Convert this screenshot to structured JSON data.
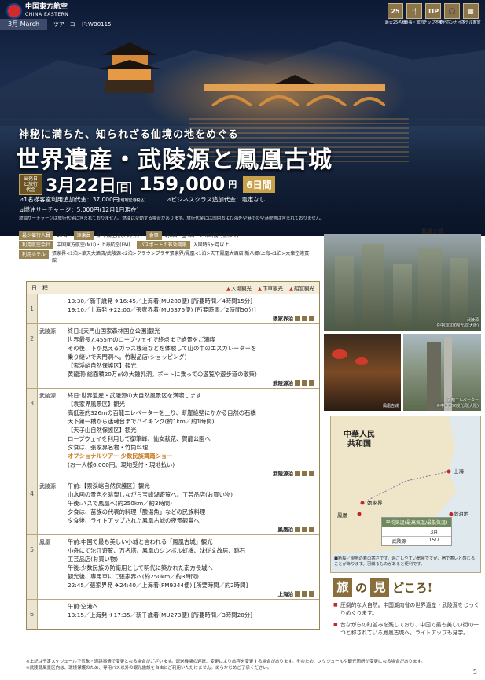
{
  "header": {
    "airline_name": "中国東方航空",
    "airline_en": "CHINA EASTERN",
    "month": "3月 March",
    "tour_code": "ツアーコード:WB0115I",
    "icons": [
      {
        "name": "max-25-icon",
        "symbol": "25",
        "label": "最大25名様"
      },
      {
        "name": "dining-icon",
        "symbol": "🍴",
        "label": "食事・飲料"
      },
      {
        "name": "no-tip-icon",
        "symbol": "TIP",
        "label": "チップ不要"
      },
      {
        "name": "earphone-icon",
        "symbol": "🎧",
        "label": "イヤホンガイド"
      },
      {
        "name": "hotel-icon",
        "symbol": "▦",
        "label": "ホテル客室"
      }
    ]
  },
  "hero": {
    "tagline": "神秘に満ちた、知られざる仙境の地をめぐる",
    "title": "世界遺産・武陵源と鳳凰古城",
    "depart_label": "出発日と旅行代金",
    "date": "3月22日",
    "weekday": "日",
    "price": "159,000",
    "yen": "円",
    "days": "6日間",
    "surcharge_single": "1名様客室利用追加代金：37,000円",
    "surcharge_single_note": "(現地空港税込)",
    "surcharge_business": "ビジネスクラス追加代金：電定なし",
    "surcharge_fuel": "燃油サーチャージ",
    "surcharge_fuel_value": "：5,000円(12月1日現在)",
    "surcharge_note": "燃油サーチャージは旅行代金に含まれておりません。燃油は変動する場合があります。旅行代金には国内および海外空港での空港税等は含まれておりません。"
  },
  "info": {
    "min_people_tag": "最少催行人員",
    "min_people": "10名",
    "escort_tag": "添乗員",
    "escort": "新千歳空港より同行",
    "meals_tag": "食事",
    "meals": "朝5回・昼4回・夕4回(機内食除く)",
    "airline_tag": "利用航空会社",
    "airline": "中国東方航空(MU)・上海航空(FM)",
    "passport_tag": "パスポートの有効期限",
    "passport": "入国時6ヶ月以上",
    "hotel_tag": "利用ホテル",
    "hotel": "張家界<1泊>華天大酒店/武陵源<2泊>クラウンプラザ張家界/鳳凰<1泊>天下鳳凰大酒店 新八郷/上海<1泊>大衆空港賓館"
  },
  "itinerary": {
    "head_day": "日　程",
    "legend_entry": "入場観光",
    "legend_exit": "下車観光",
    "legend_window": "船窓観光",
    "days": [
      {
        "num": "1",
        "place": "",
        "lines": [
          "13:30／新千歳発 ✈16:45／上海着(MU280便) [所要時間／4時間15分]",
          "19:10／上海発 ✈22:00／張家界着(MU5375便) [所要時間／2時間50分]"
        ],
        "stay": "張家界泊"
      },
      {
        "num": "2",
        "place": "武陵源",
        "lines": [
          "終日:[天門山国家森林国立公園]観光",
          "世界最長7,455mのロープウェイで終点まで絶景をご満喫",
          "その後、下が見えるガラス桟道などを体験して山の中のエスカレーターを",
          "乗り継いで天門洞へ。竹製品店(ショッピング)",
          "【索渓峪自然保護区】観光",
          "黄龍洞(総面積20万㎡の大鍾乳洞。ボートに乗っての遊覧や遊歩道の散策)"
        ],
        "stay": "武陵源泊"
      },
      {
        "num": "3",
        "place": "武陵源",
        "lines": [
          "終日:世界遺産・武陵源の大自然風景区を満喫します",
          "【袁家界風景区】観光",
          "高低差約326mの百龍エレベーターを上り、断崖絶壁にかかる自然の石橋",
          "天下第一橋から迷魂台までハイキング(約1km／約1時間)",
          "【天子山自然保護区】観光",
          "ロープウェイを利用して御筆峰、仙女献花、賀龍公園へ",
          "夕食は、張家界名物・竹筒料理",
          "オプショナルツアー 少数民族舞踊ショー",
          "(お一人様6,000円。現地受付・現地払い)"
        ],
        "stay": "武陵源泊"
      },
      {
        "num": "4",
        "place": "武陵源",
        "lines": [
          "午前:【索渓峪自然保護区】観光",
          "山水画の景色を眺望しながら宝峰湖遊覧へ。工芸品店(お買い物)",
          "午後:バスで鳳凰へ(約250km／約3時間)",
          "夕食は、苗族の代表的料理「酸湯魚」などの民族料理",
          "夕食後、ライトアップされた鳳凰古城の夜景観賞へ"
        ],
        "stay": "鳳凰泊"
      },
      {
        "num": "5",
        "place": "鳳凰",
        "lines": [
          "午前:中国で最も美しい小城と言われる「鳳凰古城」観光",
          "小舟にて沱江遊覧、万名塔、鳳凰のシンボル虹橋、沈従文故居、跳石",
          "工芸品店(お買い物)",
          "午後:少数民族の防衛用として明代に築かれた南方長城へ",
          "観光後、専用車にて張家界へ(約250km／約3時間)",
          "22:45／張家界発 ✈24:40／上海着(FM9344便) [所要時間／約2時間]"
        ],
        "stay": "上海泊"
      },
      {
        "num": "6",
        "place": "",
        "lines": [
          "午前:空港へ",
          "13:15／上海発 ✈17:35／新千歳着(MU273便) [所要時間／3時間20分]"
        ],
        "stay": ""
      }
    ]
  },
  "photos": {
    "top_label": "鳳凰古城",
    "p1_caption": "武陵源",
    "p1_credit": "©中国国家観光局(大阪)",
    "p2_caption": "鳳凰古城",
    "p3_caption": "百龍エレベーター",
    "p3_credit": "©中国国家観光局(大阪)"
  },
  "map": {
    "country": "中華人民\n共和国",
    "cities": [
      "張家界",
      "鳳凰",
      "上海",
      "宿泊地"
    ],
    "temp_header": "平均気温(最高気温/最低気温)",
    "temp_month": "3月",
    "temp_city": "武陵源",
    "temp_value": "15/7",
    "note": "■新桜／現地の着の寒さです。過ごしやすい気候ですが、宿で寒いと感じることがあります。羽織るものがあると便利です。"
  },
  "highlights": {
    "k1": "旅",
    "mid": "の",
    "k2": "見",
    "tail": "どころ!",
    "items": [
      "圧倒的な大自然。中国湖南省の世界遺産・武陵源をじっくりめぐります。",
      "昔ながらの町並みを残しており、中国で最も美しい街の一つと称されている鳳凰古城へ。ライトアップも見学。"
    ]
  },
  "footnotes": [
    "※上記は予定スケジュールで気象・道路事情で変更となる場合がございます。運送機関の遅延、変更により旅程を変更する場合があります。そのため、スケジュールや観光箇所が変更になる場合があります。",
    "※武陵源風景区内は、環境保護のため、専用バス以外の観光施設を自由にご利用いただけません。あらかじめご了承ください。"
  ],
  "page_number": "5"
}
